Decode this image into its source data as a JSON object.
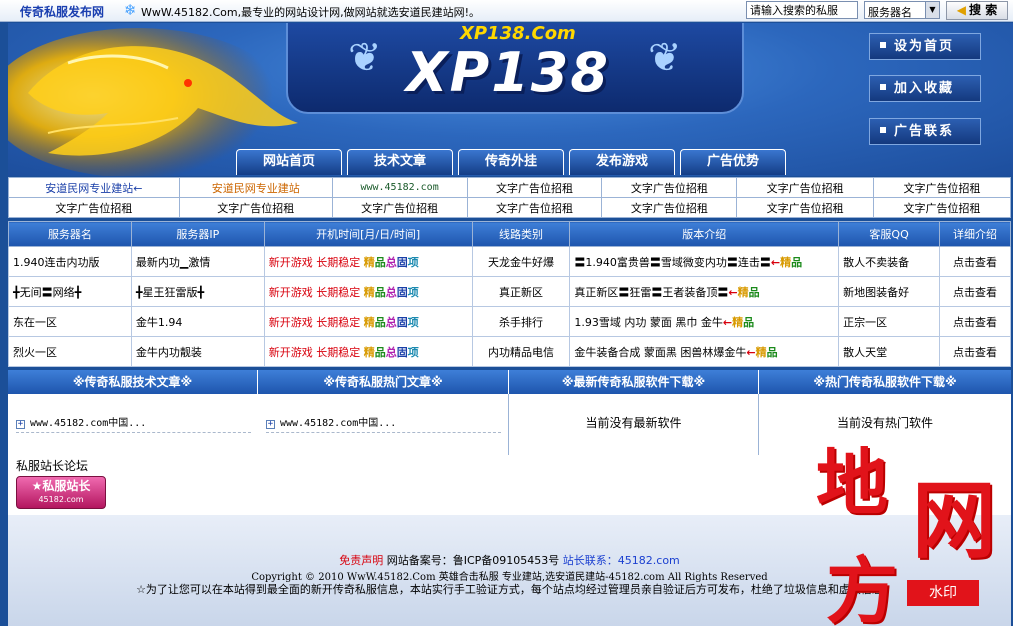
{
  "topbar": {
    "brand": "传奇私服发布网",
    "notice": "WwW.45182.Com,最专业的网站设计网,做网站就选安道民建站网!。",
    "search_placeholder": "请输入搜索的私服",
    "select_value": "服务器名",
    "search_button": "搜 索"
  },
  "header": {
    "logo_small": "XP138.Com",
    "logo_big": "XP138",
    "side_buttons": [
      "设为首页",
      "加入收藏",
      "广告联系"
    ],
    "nav": [
      "网站首页",
      "技术文章",
      "传奇外挂",
      "发布游戏",
      "广告优势"
    ]
  },
  "links": {
    "row1": [
      "安道民网专业建站←",
      "安道民网专业建站",
      "www.45182.com",
      "文字广告位招租",
      "文字广告位招租",
      "文字广告位招租",
      "文字广告位招租"
    ],
    "row2": [
      "文字广告位招租",
      "文字广告位招租",
      "文字广告位招租",
      "文字广告位招租",
      "文字广告位招租",
      "文字广告位招租",
      "文字广告位招租"
    ]
  },
  "servers": {
    "headers": [
      "服务器名",
      "服务器IP",
      "开机时间[月/日/时间]",
      "线路类别",
      "版本介绍",
      "客服QQ",
      "详细介绍"
    ],
    "open_new": "新开游戏",
    "stable": "长期稳定",
    "tags": [
      "精",
      "品",
      "总",
      "固",
      "项"
    ],
    "arrow": "←",
    "rows": [
      {
        "name": "1.940连击内功版",
        "ip": "最新内功▁激情",
        "line": "天龙金牛好爆",
        "version": "〓1.940富贵兽〓雪域微变内功〓连击〓",
        "version_tag": [
          "精",
          "品"
        ],
        "qq": "散人不卖装备",
        "detail": "点击查看"
      },
      {
        "name": "╋无间〓网络╋",
        "ip": "╋星王狂雷版╋",
        "line": "真正新区",
        "version": "真正新区〓狂雷〓王者装备顶〓",
        "version_tag": [
          "精",
          "品"
        ],
        "qq": "新地图装备好",
        "detail": "点击查看"
      },
      {
        "name": "东在一区",
        "ip": "金牛1.94",
        "line": "杀手排行",
        "version": "1.93雪域 内功 蒙面 黑巾 金牛",
        "version_tag": [
          "精",
          "品"
        ],
        "qq": "正宗一区",
        "detail": "点击查看"
      },
      {
        "name": "烈火一区",
        "ip": "金牛内功靓装",
        "line": "内功精品电信",
        "version": "金牛装备合成 蒙面黑 困兽林爆金牛",
        "version_tag": [
          "精",
          "品"
        ],
        "qq": "散人天堂",
        "detail": "点击查看"
      }
    ]
  },
  "sections": {
    "heads": [
      "※传奇私服技术文章※",
      "※传奇私服热门文章※",
      "※最新传奇私服软件下载※",
      "※热门传奇私服软件下载※"
    ],
    "article1": "www.45182.com中国...",
    "article2": "www.45182.com中国...",
    "empty_new": "当前没有最新软件",
    "empty_hot": "当前没有热门软件"
  },
  "forum": {
    "label": "私服站长论坛",
    "badge_title": "私服站长",
    "badge_url": "45182.com"
  },
  "footer": {
    "disclaimer": "免责声明",
    "icp": "网站备案号：鲁ICP备09105453号",
    "contact": "站长联系：45182.com",
    "copyright": "Copyright © 2010 WwW.45182.Com 英雄合击私服 专业建站,选安道民建站-45182.com All Rights Reserved",
    "note": "☆为了让您可以在本站得到最全面的新开传奇私服信息，本站实行手工验证方式，每个站点均经过管理员亲自验证后方可发布，杜绝了垃圾信息和虚假信息"
  },
  "watermark": {
    "chars": [
      "地",
      "网",
      "方"
    ],
    "stamp": "水印"
  },
  "colors": {
    "primary_blue": "#1e55ad",
    "background_blue": "#1b4f98",
    "accent_red": "#d8000c",
    "gold": "#ffd800"
  }
}
